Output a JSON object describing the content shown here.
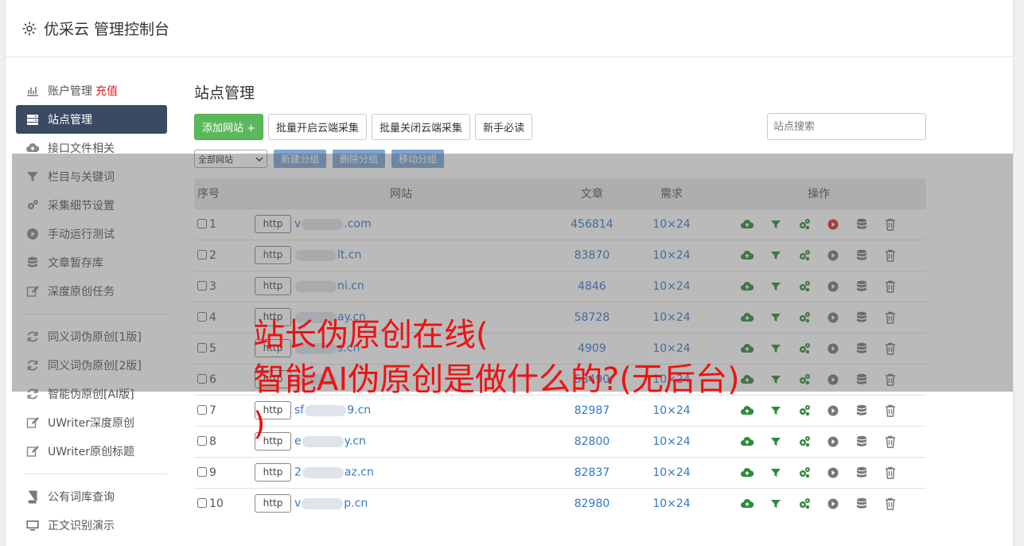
{
  "header": {
    "title": "优采云 管理控制台"
  },
  "sidebar": {
    "items": [
      {
        "label": "账户管理",
        "extra": "充值",
        "icon": "bar-chart-icon"
      },
      {
        "label": "站点管理",
        "icon": "server-icon",
        "active": true
      },
      {
        "label": "接口文件相关",
        "icon": "cloud-upload-icon"
      },
      {
        "label": "栏目与关键词",
        "icon": "filter-icon"
      },
      {
        "label": "采集细节设置",
        "icon": "cogs-icon"
      },
      {
        "label": "手动运行测试",
        "icon": "play-circle-icon"
      },
      {
        "label": "文章暂存库",
        "icon": "database-icon"
      },
      {
        "label": "深度原创任务",
        "icon": "edit-icon"
      }
    ],
    "items2": [
      {
        "label": "同义词伪原创[1版]",
        "icon": "refresh-icon"
      },
      {
        "label": "同义词伪原创[2版]",
        "icon": "refresh-icon"
      },
      {
        "label": "智能伪原创[AI版]",
        "icon": "refresh-icon"
      },
      {
        "label": "UWriter深度原创",
        "icon": "edit-icon"
      },
      {
        "label": "UWriter原创标题",
        "icon": "edit-icon"
      }
    ],
    "items3": [
      {
        "label": "公有词库查询",
        "icon": "book-icon"
      },
      {
        "label": "正文识别演示",
        "icon": "monitor-icon"
      }
    ]
  },
  "main": {
    "title": "站点管理",
    "buttons": {
      "add": "添加网站 +",
      "batch_on": "批量开启云端采集",
      "batch_off": "批量关闭云端采集",
      "guide": "新手必读"
    },
    "search_placeholder": "站点搜索",
    "group_select": "全部网站",
    "group_buttons": {
      "new": "新建分组",
      "delete": "删除分组",
      "move": "移动分组"
    },
    "columns": {
      "no": "序号",
      "site": "网站",
      "articles": "文章",
      "demand": "需求",
      "ops": "操作"
    },
    "rows": [
      {
        "no": "1",
        "prefix": "v",
        "suffix": ".com",
        "articles": "456814",
        "demand": "10×24",
        "play_active": true
      },
      {
        "no": "2",
        "prefix": "",
        "suffix": "lt.cn",
        "articles": "83870",
        "demand": "10×24"
      },
      {
        "no": "3",
        "prefix": "",
        "suffix": "ni.cn",
        "articles": "4846",
        "demand": "10×24"
      },
      {
        "no": "4",
        "prefix": "",
        "suffix": "ay.cn",
        "articles": "58728",
        "demand": "10×24"
      },
      {
        "no": "5",
        "prefix": "",
        "suffix": "s.cn",
        "articles": "4909",
        "demand": "10×24"
      },
      {
        "no": "6",
        "prefix": "",
        "suffix": "",
        "articles": "58490",
        "demand": "10×24"
      },
      {
        "no": "7",
        "prefix": "sf",
        "suffix": "9.cn",
        "articles": "82987",
        "demand": "10×24"
      },
      {
        "no": "8",
        "prefix": "e",
        "suffix": "y.cn",
        "articles": "82800",
        "demand": "10×24"
      },
      {
        "no": "9",
        "prefix": "2",
        "suffix": "az.cn",
        "articles": "82837",
        "demand": "10×24"
      },
      {
        "no": "10",
        "prefix": "v",
        "suffix": "p.cn",
        "articles": "82980",
        "demand": "10×24"
      }
    ],
    "http_label": "http"
  },
  "watermark": {
    "line1": "站长伪原创在线(",
    "line2": "智能AI伪原创是做什么的?(无后台)",
    "line3": ")"
  },
  "colors": {
    "accent_green": "#5cb85c",
    "active_nav": "#3b4a63",
    "link": "#3478c5",
    "watermark": "#f01010"
  }
}
